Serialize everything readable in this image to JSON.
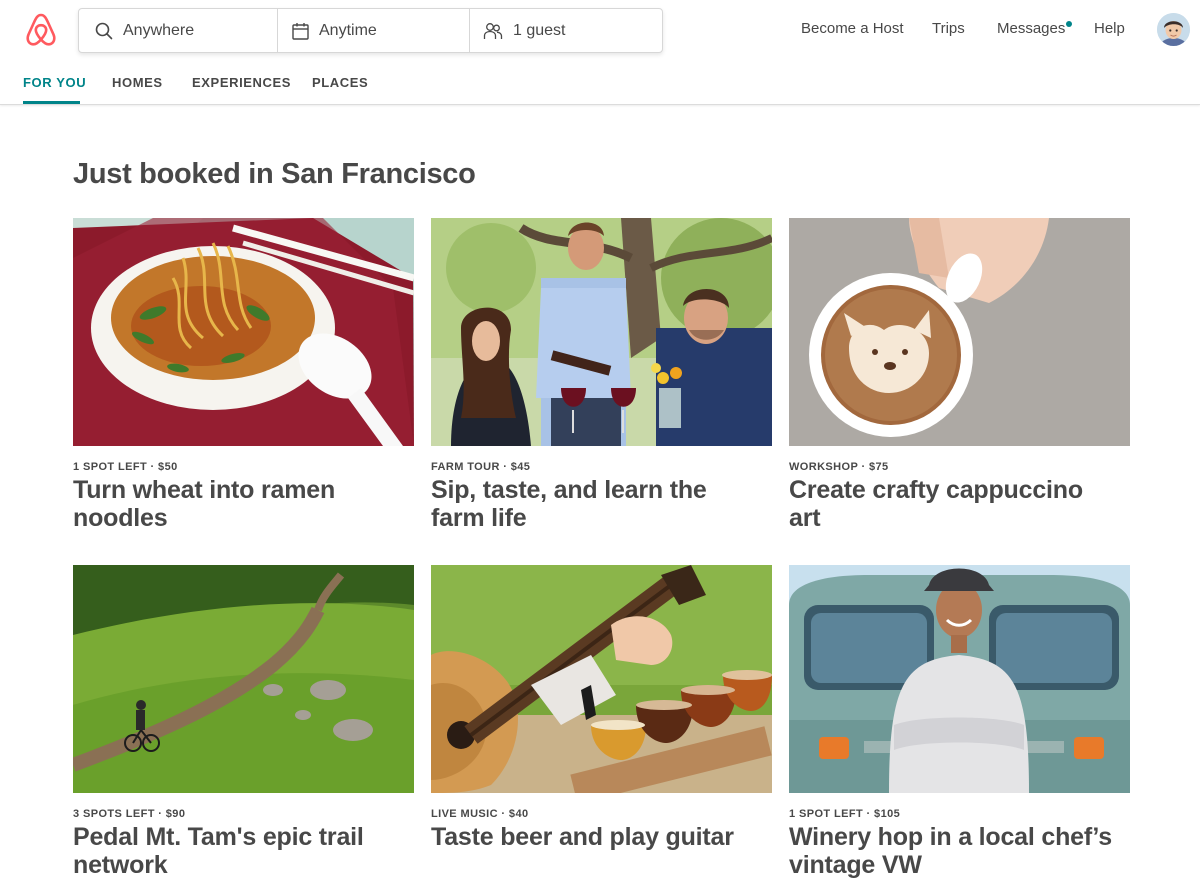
{
  "search": {
    "location": "Anywhere",
    "dates": "Anytime",
    "guests": "1 guest"
  },
  "nav": {
    "become_host": "Become a Host",
    "trips": "Trips",
    "messages": "Messages",
    "help": "Help"
  },
  "tabs": [
    {
      "label": "FOR YOU",
      "active": true
    },
    {
      "label": "HOMES",
      "active": false
    },
    {
      "label": "EXPERIENCES",
      "active": false
    },
    {
      "label": "PLACES",
      "active": false
    }
  ],
  "section": {
    "title": "Just booked in San Francisco"
  },
  "cards": [
    {
      "meta": "1 SPOT LEFT · $50",
      "title": "Turn wheat into ramen noodles",
      "image": "ramen-noodles-photo"
    },
    {
      "meta": "FARM TOUR · $45",
      "title": "Sip, taste, and learn the farm life",
      "image": "wine-tasting-photo"
    },
    {
      "meta": "WORKSHOP · $75",
      "title": "Create crafty cappuccino art",
      "image": "corgi-latte-art-photo"
    },
    {
      "meta": "3 SPOTS LEFT · $90",
      "title": "Pedal Mt. Tam's epic trail network",
      "image": "mountain-bike-trail-photo"
    },
    {
      "meta": "LIVE MUSIC · $40",
      "title": "Taste beer and play guitar",
      "image": "beer-flight-guitar-photo"
    },
    {
      "meta": "1 SPOT LEFT · $105",
      "title": "Winery hop in a local chef’s vintage VW",
      "image": "vintage-vw-bus-photo"
    }
  ],
  "colors": {
    "brand": "#FF5A5F",
    "accent": "#008489",
    "text": "#484848"
  }
}
